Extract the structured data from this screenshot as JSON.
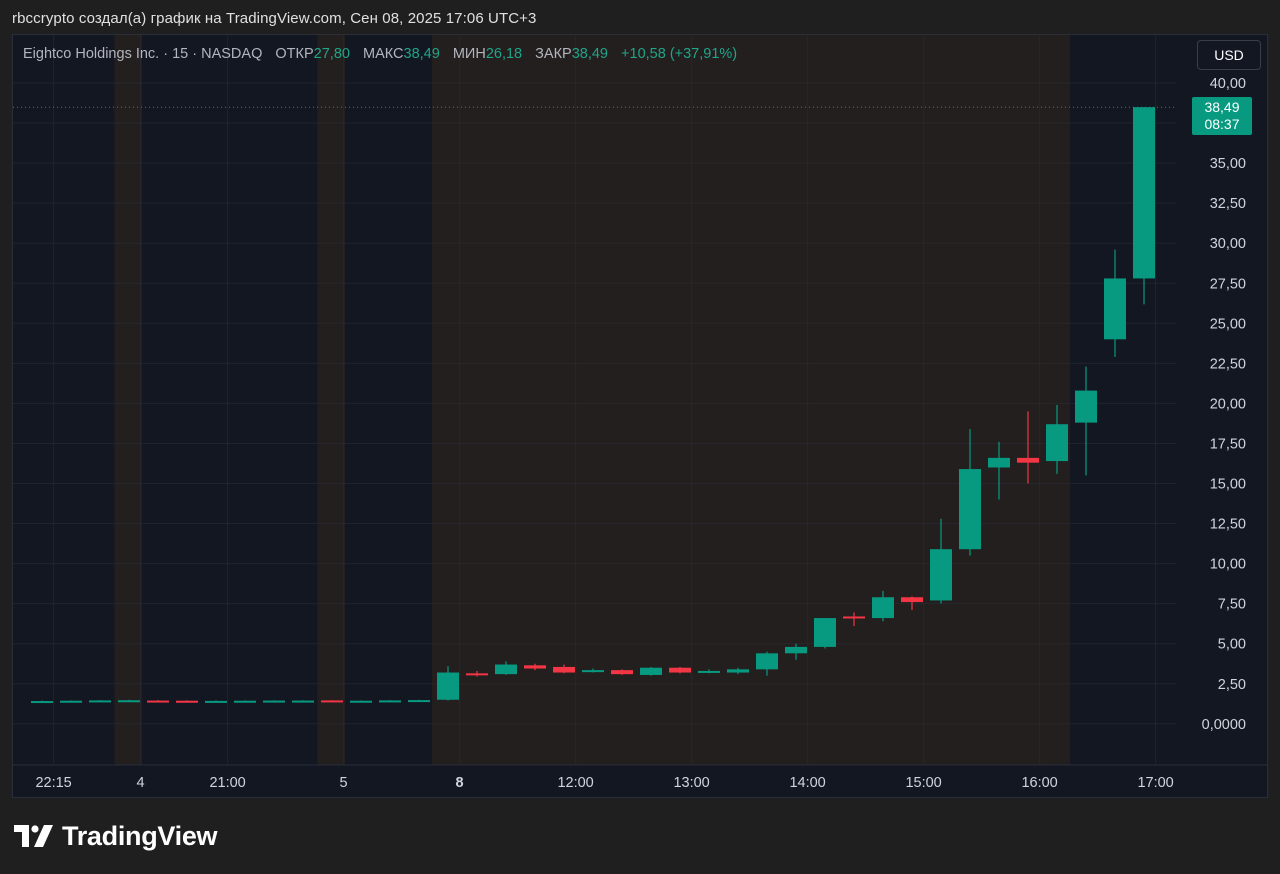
{
  "caption": "rbccrypto создал(а) график на TradingView.com, Сен 08, 2025 17:06 UTC+3",
  "legend": {
    "symbol": "Eightco Holdings Inc. · 15 · NASDAQ",
    "open_label": "ОТКР",
    "open": "27,80",
    "high_label": "МАКС",
    "high": "38,49",
    "low_label": "МИН",
    "low": "26,18",
    "close_label": "ЗАКР",
    "close": "38,49",
    "change": "+10,58 (+37,91%)"
  },
  "currency_button": "USD",
  "last_price": {
    "price": "38,49",
    "countdown": "08:37"
  },
  "brand": {
    "name": "TradingView",
    "logo_icon": "tradingview-logo-icon"
  },
  "colors": {
    "up": "#089981",
    "down": "#f23645",
    "background": "#131722",
    "grid": "#2a2e39"
  },
  "chart_data": {
    "type": "candlestick",
    "interval": "15",
    "ylim": [
      -1.5,
      41.5
    ],
    "y_ticks": [
      {
        "value": 40,
        "label": "40,00"
      },
      {
        "value": 37.5,
        "label": ""
      },
      {
        "value": 35,
        "label": "35,00"
      },
      {
        "value": 32.5,
        "label": "32,50"
      },
      {
        "value": 30,
        "label": "30,00"
      },
      {
        "value": 27.5,
        "label": "27,50"
      },
      {
        "value": 25,
        "label": "25,00"
      },
      {
        "value": 22.5,
        "label": "22,50"
      },
      {
        "value": 20,
        "label": "20,00"
      },
      {
        "value": 17.5,
        "label": "17,50"
      },
      {
        "value": 15,
        "label": "15,00"
      },
      {
        "value": 12.5,
        "label": "12,50"
      },
      {
        "value": 10,
        "label": "10,00"
      },
      {
        "value": 7.5,
        "label": "7,50"
      },
      {
        "value": 5,
        "label": "5,00"
      },
      {
        "value": 2.5,
        "label": "2,50"
      },
      {
        "value": 0,
        "label": "0,0000"
      }
    ],
    "x_ticks": [
      {
        "bar": 0.4,
        "label": "22:15",
        "bold": false
      },
      {
        "bar": 3.4,
        "label": "4",
        "bold": false
      },
      {
        "bar": 6.4,
        "label": "21:00",
        "bold": false
      },
      {
        "bar": 10.4,
        "label": "5",
        "bold": false
      },
      {
        "bar": 14.4,
        "label": "8",
        "bold": true
      },
      {
        "bar": 18.4,
        "label": "12:00",
        "bold": false
      },
      {
        "bar": 22.4,
        "label": "13:00",
        "bold": false
      },
      {
        "bar": 26.4,
        "label": "14:00",
        "bold": false
      },
      {
        "bar": 30.4,
        "label": "15:00",
        "bold": false
      },
      {
        "bar": 34.4,
        "label": "16:00",
        "bold": false
      },
      {
        "bar": 38.4,
        "label": "17:00",
        "bold": false
      }
    ],
    "sessions": [
      {
        "kind": "extended",
        "from": 3.0,
        "to": 3.95
      },
      {
        "kind": "extended",
        "from": 10.0,
        "to": 10.95
      },
      {
        "kind": "extended",
        "from": 13.95,
        "to": 35.95
      }
    ],
    "last_price_line": 38.49,
    "candles": [
      {
        "o": 1.4,
        "h": 1.45,
        "l": 1.36,
        "c": 1.42
      },
      {
        "o": 1.42,
        "h": 1.46,
        "l": 1.38,
        "c": 1.44
      },
      {
        "o": 1.44,
        "h": 1.48,
        "l": 1.4,
        "c": 1.46
      },
      {
        "o": 1.46,
        "h": 1.5,
        "l": 1.42,
        "c": 1.47
      },
      {
        "o": 1.45,
        "h": 1.48,
        "l": 1.4,
        "c": 1.44
      },
      {
        "o": 1.44,
        "h": 1.47,
        "l": 1.38,
        "c": 1.42
      },
      {
        "o": 1.4,
        "h": 1.46,
        "l": 1.37,
        "c": 1.43
      },
      {
        "o": 1.42,
        "h": 1.46,
        "l": 1.39,
        "c": 1.44
      },
      {
        "o": 1.43,
        "h": 1.47,
        "l": 1.4,
        "c": 1.45
      },
      {
        "o": 1.44,
        "h": 1.47,
        "l": 1.41,
        "c": 1.45
      },
      {
        "o": 1.46,
        "h": 1.48,
        "l": 1.38,
        "c": 1.4
      },
      {
        "o": 1.4,
        "h": 1.46,
        "l": 1.38,
        "c": 1.44
      },
      {
        "o": 1.44,
        "h": 1.48,
        "l": 1.41,
        "c": 1.46
      },
      {
        "o": 1.46,
        "h": 1.5,
        "l": 1.43,
        "c": 1.48
      },
      {
        "o": 1.5,
        "h": 3.6,
        "l": 1.45,
        "c": 3.2
      },
      {
        "o": 3.15,
        "h": 3.3,
        "l": 2.95,
        "c": 3.1
      },
      {
        "o": 3.1,
        "h": 3.9,
        "l": 3.05,
        "c": 3.7
      },
      {
        "o": 3.65,
        "h": 3.75,
        "l": 3.35,
        "c": 3.45
      },
      {
        "o": 3.55,
        "h": 3.7,
        "l": 3.15,
        "c": 3.2
      },
      {
        "o": 3.3,
        "h": 3.45,
        "l": 3.2,
        "c": 3.35
      },
      {
        "o": 3.35,
        "h": 3.4,
        "l": 3.05,
        "c": 3.1
      },
      {
        "o": 3.05,
        "h": 3.55,
        "l": 3.0,
        "c": 3.5
      },
      {
        "o": 3.5,
        "h": 3.55,
        "l": 3.15,
        "c": 3.2
      },
      {
        "o": 3.2,
        "h": 3.4,
        "l": 3.15,
        "c": 3.3
      },
      {
        "o": 3.2,
        "h": 3.5,
        "l": 3.1,
        "c": 3.4
      },
      {
        "o": 3.4,
        "h": 4.5,
        "l": 3.0,
        "c": 4.4
      },
      {
        "o": 4.4,
        "h": 5.0,
        "l": 4.0,
        "c": 4.8
      },
      {
        "o": 4.8,
        "h": 6.6,
        "l": 4.7,
        "c": 6.6
      },
      {
        "o": 6.7,
        "h": 6.95,
        "l": 6.1,
        "c": 6.6
      },
      {
        "o": 6.6,
        "h": 8.3,
        "l": 6.4,
        "c": 7.9
      },
      {
        "o": 7.9,
        "h": 7.95,
        "l": 7.1,
        "c": 7.6
      },
      {
        "o": 7.7,
        "h": 12.8,
        "l": 7.5,
        "c": 10.9
      },
      {
        "o": 10.9,
        "h": 18.4,
        "l": 10.5,
        "c": 15.9
      },
      {
        "o": 16.0,
        "h": 17.6,
        "l": 14.0,
        "c": 16.6
      },
      {
        "o": 16.6,
        "h": 19.5,
        "l": 15.0,
        "c": 16.3
      },
      {
        "o": 16.4,
        "h": 19.9,
        "l": 15.6,
        "c": 18.7
      },
      {
        "o": 18.8,
        "h": 22.3,
        "l": 15.5,
        "c": 20.8
      },
      {
        "o": 24.0,
        "h": 29.6,
        "l": 22.9,
        "c": 27.8
      },
      {
        "o": 27.8,
        "h": 38.49,
        "l": 26.18,
        "c": 38.49
      }
    ]
  }
}
